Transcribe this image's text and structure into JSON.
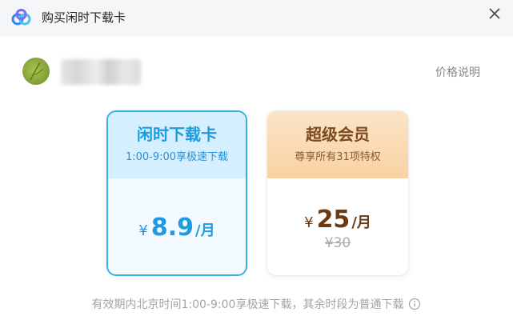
{
  "window": {
    "title": "购买闲时下载卡"
  },
  "header": {
    "price_note": "价格说明"
  },
  "cards": [
    {
      "title": "闲时下载卡",
      "subtitle": "1:00-9:00享极速下载",
      "currency": "¥",
      "price": "8.9",
      "unit": "/月",
      "selected": true
    },
    {
      "title": "超级会员",
      "subtitle": "尊享所有31项特权",
      "currency": "¥",
      "price": "25",
      "unit": "/月",
      "original_price": "¥30",
      "selected": false
    }
  ],
  "footer": {
    "note": "有效期内北京时间1:00-9:00享极速下载，其余时段为普通下载"
  },
  "colors": {
    "accent": "#1e9ae0",
    "vip": "#6b3a12",
    "muted": "#a3a3a3"
  },
  "icons": {
    "logo": "cloud-logo-icon",
    "close": "close-icon",
    "info": "info-icon"
  }
}
